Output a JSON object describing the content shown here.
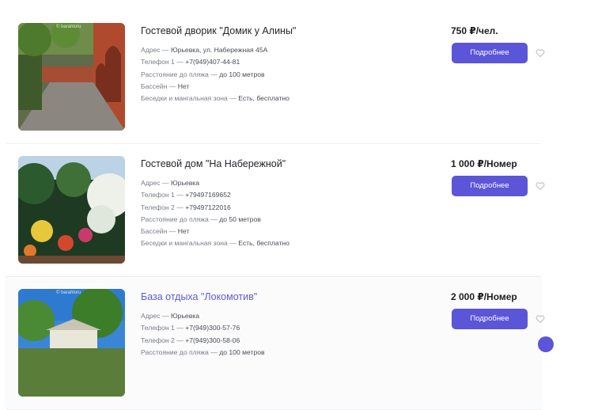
{
  "listings": [
    {
      "title": "Гостевой дворик \"Домик у Алины\"",
      "price": "750 ₽/чел.",
      "button_label": "Подробнее",
      "watermark": "© barahloru",
      "details": [
        {
          "key": "Адрес",
          "sep": " — ",
          "value": "Юрьевка, ул. Набережная 45А"
        },
        {
          "key": "Телефон 1",
          "sep": " — ",
          "value": "+7(949)407-44-81"
        },
        {
          "key": "Расстояние до пляжа",
          "sep": " — ",
          "value": "до 100 метров"
        },
        {
          "key": "Бассейн",
          "sep": " — ",
          "value": "Нет"
        },
        {
          "key": "Беседки и мангальная зона",
          "sep": " — ",
          "value": "Есть, бесплатно"
        }
      ]
    },
    {
      "title": "Гостевой дом \"На Набережной\"",
      "price": "1 000 ₽/Номер",
      "button_label": "Подробнее",
      "details": [
        {
          "key": "Адрес",
          "sep": " — ",
          "value": "Юрьевка"
        },
        {
          "key": "Телефон 1",
          "sep": " — ",
          "value": "+79497169652"
        },
        {
          "key": "Телефон 2",
          "sep": " — ",
          "value": "+79497122016"
        },
        {
          "key": "Расстояние до пляжа",
          "sep": " — ",
          "value": "до 50 метров"
        },
        {
          "key": "Бассейн",
          "sep": " — ",
          "value": "Нет"
        },
        {
          "key": "Беседки и мангальная зона",
          "sep": " — ",
          "value": "Есть, бесплатно"
        }
      ]
    },
    {
      "title": "База отдыха \"Локомотив\"",
      "price": "2 000 ₽/Номер",
      "button_label": "Подробнее",
      "watermark": "© barahloru",
      "details": [
        {
          "key": "Адрес",
          "sep": " — ",
          "value": "Юрьевка"
        },
        {
          "key": "Телефон 1",
          "sep": " — ",
          "value": "+7(949)300-57-76"
        },
        {
          "key": "Телефон 2",
          "sep": " — ",
          "value": "+7(949)300-58-06"
        },
        {
          "key": "Расстояние до пляжа",
          "sep": " — ",
          "value": "до 100 метров"
        }
      ]
    }
  ],
  "icons": {
    "favorite": "heart-outline-icon"
  },
  "colors": {
    "accent": "#5b55d8",
    "link": "#5b5bd6"
  }
}
